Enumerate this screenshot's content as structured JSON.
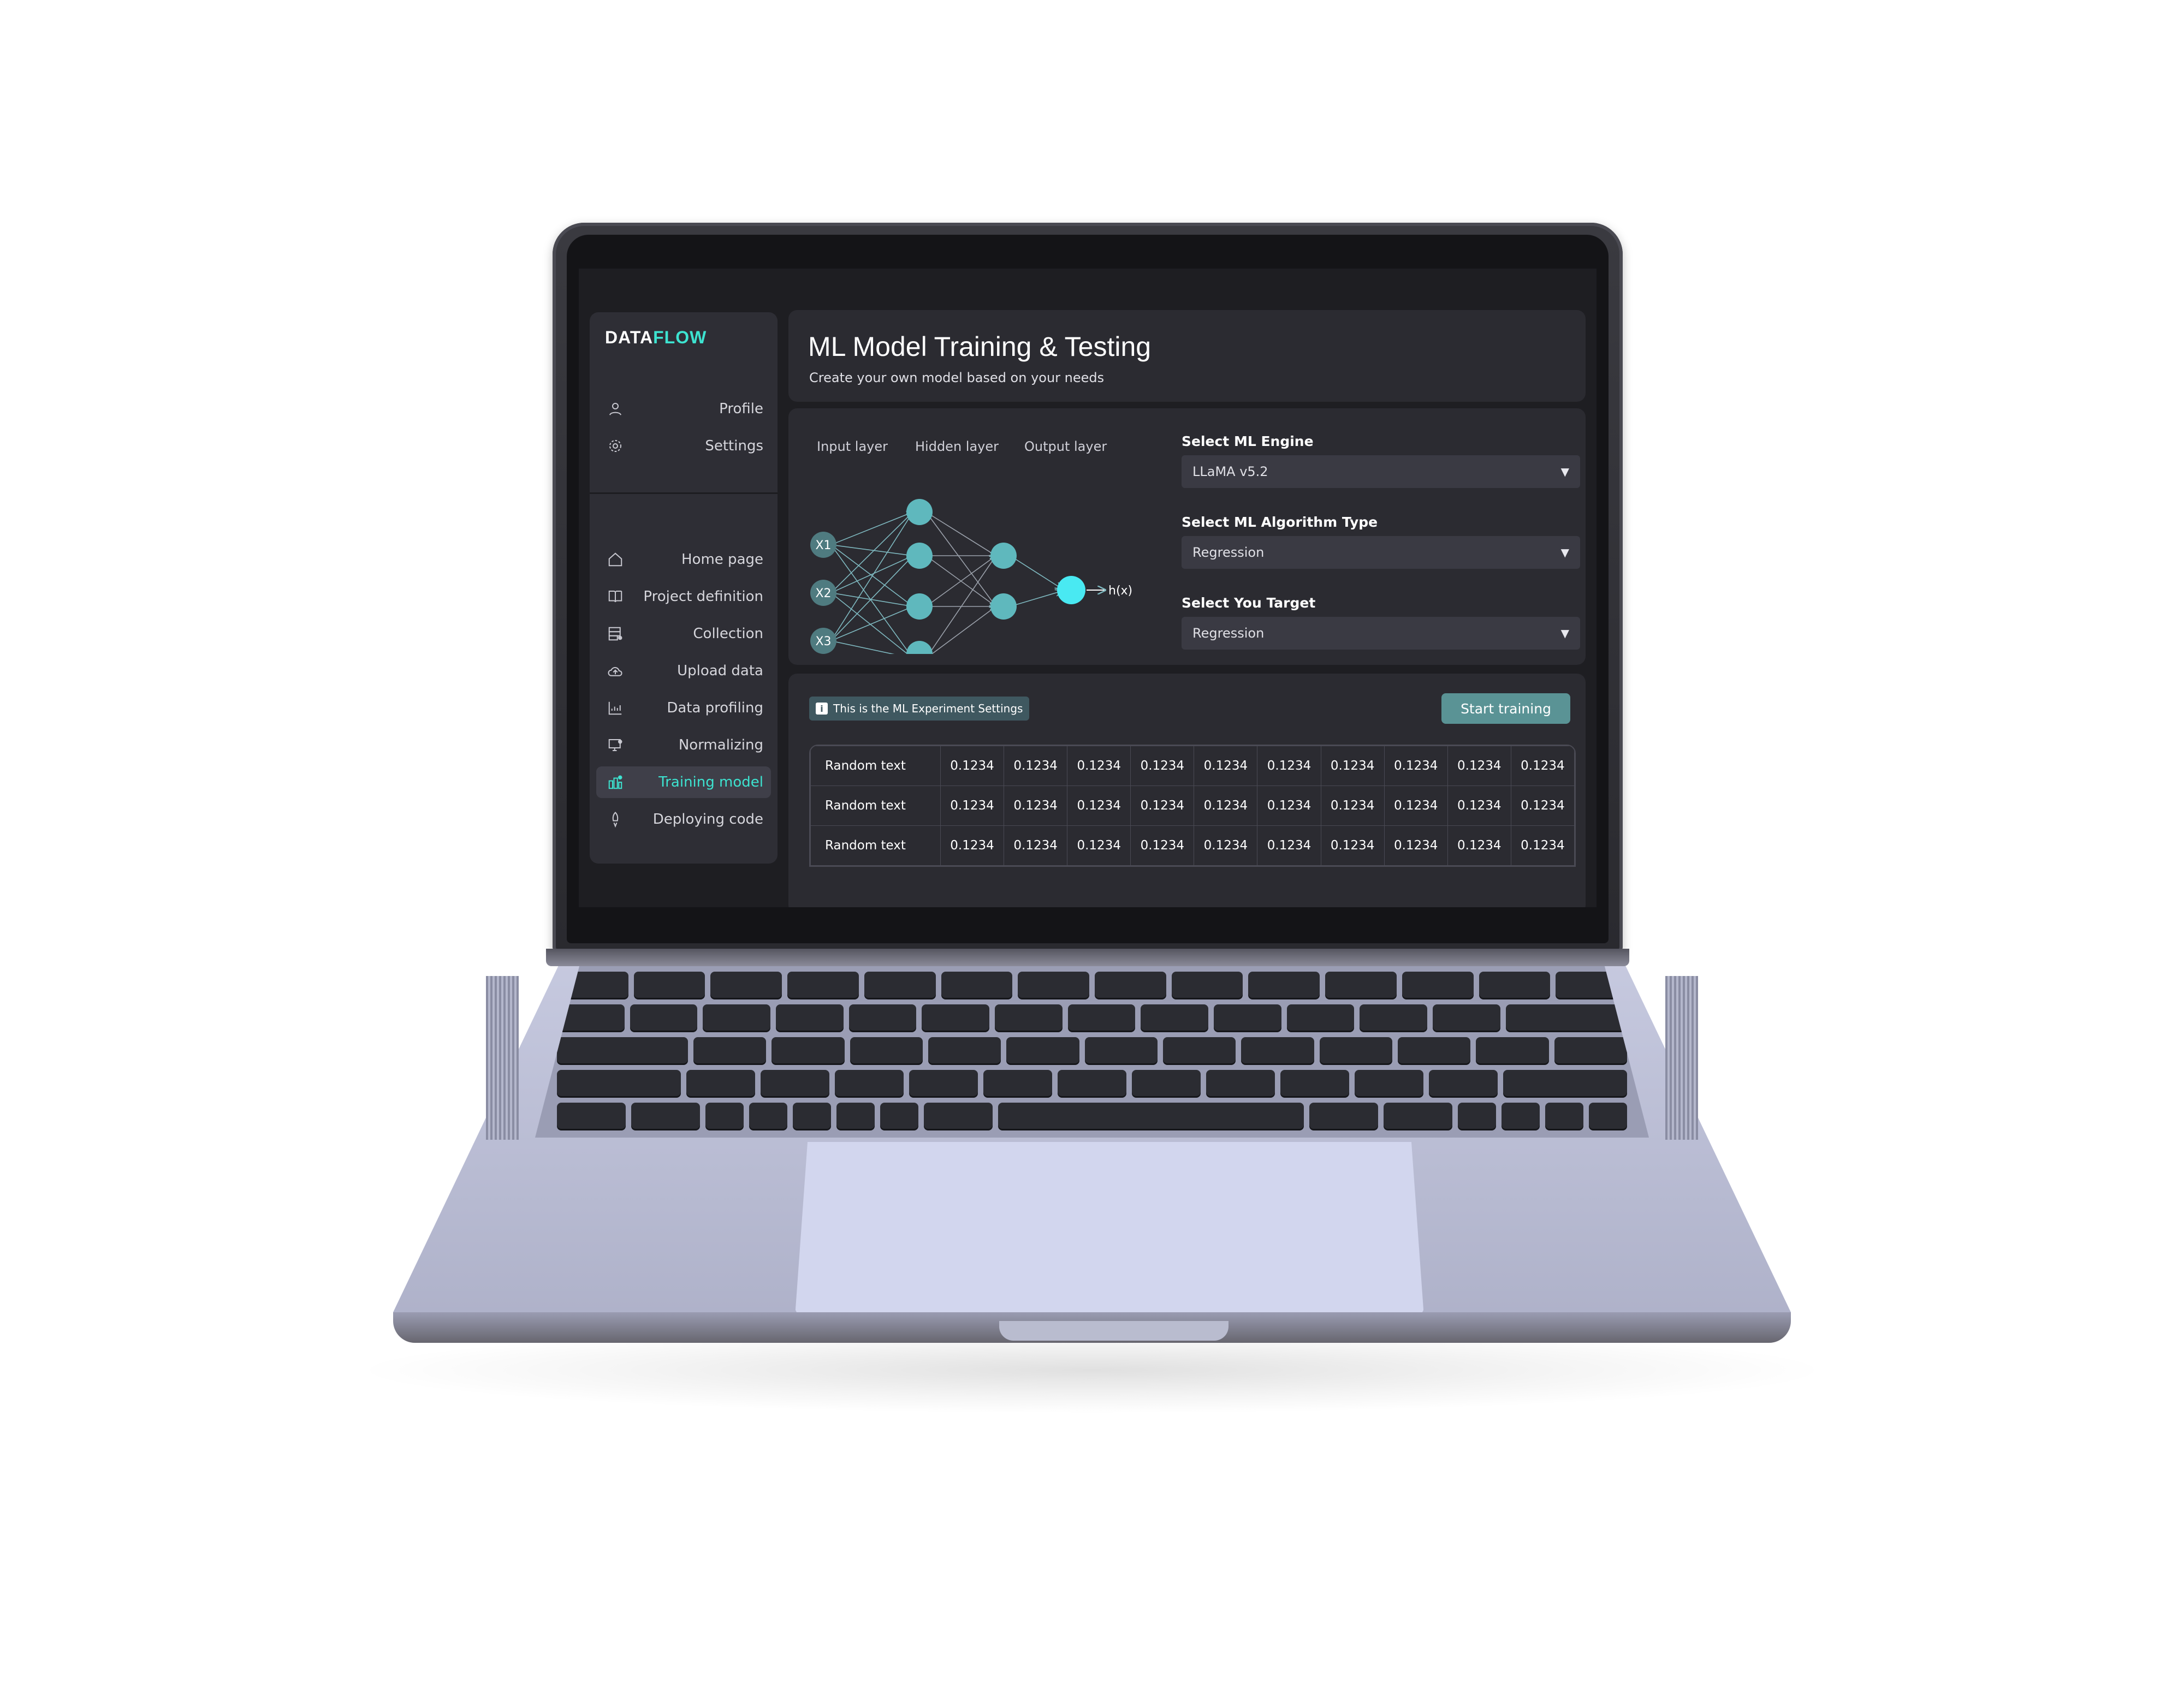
{
  "app": {
    "logo": {
      "part1": "ATA",
      "part2": "FLOW",
      "initial": "D"
    }
  },
  "sidebar": {
    "account_items": [
      {
        "label": "Profile",
        "icon": "user-icon"
      },
      {
        "label": "Settings",
        "icon": "gear-icon"
      }
    ],
    "nav_items": [
      {
        "label": "Home page",
        "icon": "home-icon"
      },
      {
        "label": "Project definition",
        "icon": "book-icon"
      },
      {
        "label": "Collection",
        "icon": "database-icon"
      },
      {
        "label": "Upload data",
        "icon": "cloud-upload-icon"
      },
      {
        "label": "Data profiling",
        "icon": "chart-icon"
      },
      {
        "label": "Normalizing",
        "icon": "monitor-icon"
      },
      {
        "label": "Training model",
        "icon": "training-icon",
        "active": true
      },
      {
        "label": "Deploying code",
        "icon": "rocket-icon"
      }
    ]
  },
  "header": {
    "title": "ML Model Training & Testing",
    "subtitle": "Create your own model based on your needs"
  },
  "network": {
    "input_label": "Input layer",
    "hidden_label": "Hidden layer",
    "output_label": "Output layer",
    "inputs": [
      "X1",
      "X2",
      "X3"
    ],
    "output": "h(x)"
  },
  "config": {
    "engine_label": "Select ML Engine",
    "engine_value": "LLaMA v5.2",
    "algorithm_label": "Select ML Algorithm Type",
    "algorithm_value": "Regression",
    "target_label": "Select You Target",
    "target_value": "Regression"
  },
  "experiment": {
    "info_text": "This is the ML Experiment Settings",
    "start_button": "Start training",
    "rows": [
      {
        "label": "Random text",
        "values": [
          "0.1234",
          "0.1234",
          "0.1234",
          "0.1234",
          "0.1234",
          "0.1234",
          "0.1234",
          "0.1234",
          "0.1234",
          "0.1234"
        ]
      },
      {
        "label": "Random text",
        "values": [
          "0.1234",
          "0.1234",
          "0.1234",
          "0.1234",
          "0.1234",
          "0.1234",
          "0.1234",
          "0.1234",
          "0.1234",
          "0.1234"
        ]
      },
      {
        "label": "Random text",
        "values": [
          "0.1234",
          "0.1234",
          "0.1234",
          "0.1234",
          "0.1234",
          "0.1234",
          "0.1234",
          "0.1234",
          "0.1234",
          "0.1234"
        ]
      }
    ]
  },
  "colors": {
    "accent": "#3de3d0",
    "node": "#5fb8bd",
    "output_node": "#49e9f2",
    "button": "#5a9395",
    "panel": "#2b2b31",
    "laptop_body": "#c2c5dc"
  }
}
